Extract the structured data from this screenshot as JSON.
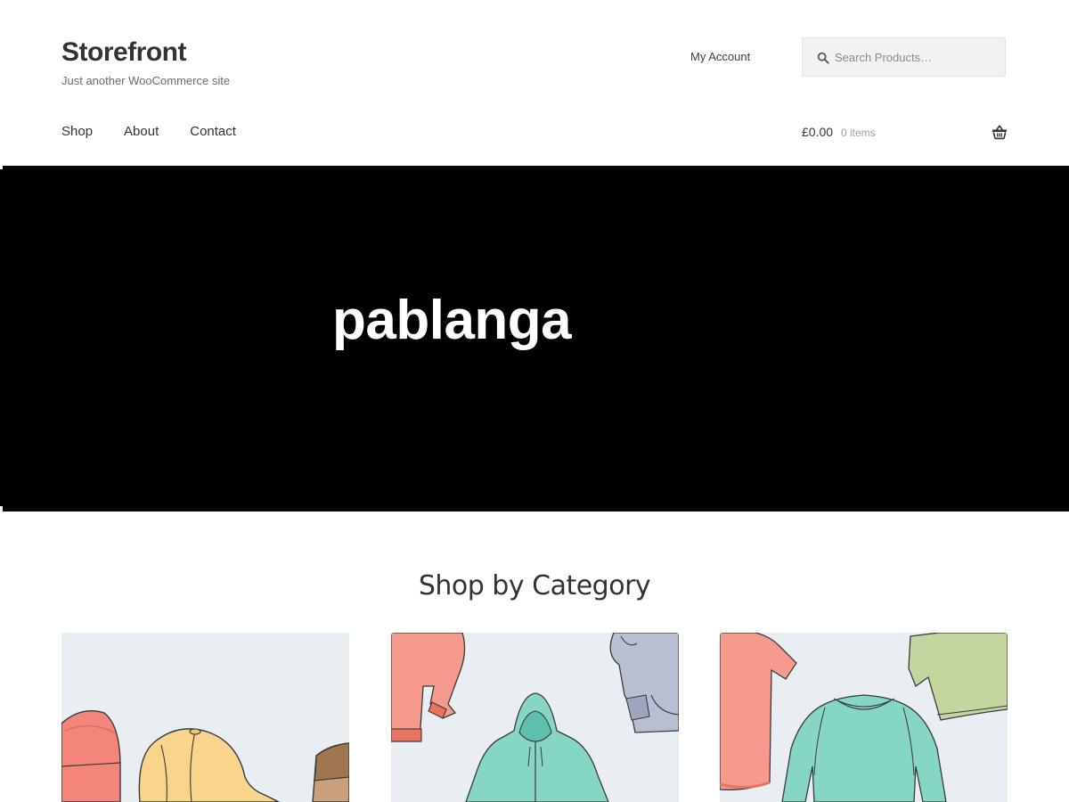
{
  "header": {
    "site_title": "Storefront",
    "tagline": "Just another WooCommerce site",
    "account_link": "My Account",
    "search": {
      "placeholder": "Search Products…",
      "value": ""
    }
  },
  "nav": {
    "items": [
      {
        "label": "Shop"
      },
      {
        "label": "About"
      },
      {
        "label": "Contact"
      }
    ]
  },
  "cart": {
    "total": "£0.00",
    "count": "0 items"
  },
  "hero": {
    "title": "pablanga",
    "background": "#000000"
  },
  "categories": {
    "title": "Shop by Category",
    "cards": [
      {
        "image": "hats-illustration"
      },
      {
        "image": "hoodies-illustration"
      },
      {
        "image": "tshirts-illustration"
      }
    ]
  },
  "colors": {
    "text": "#333333",
    "muted": "#6d6d6d",
    "search_bg": "#f2f2f2",
    "card_bg": "#e9eef2"
  }
}
